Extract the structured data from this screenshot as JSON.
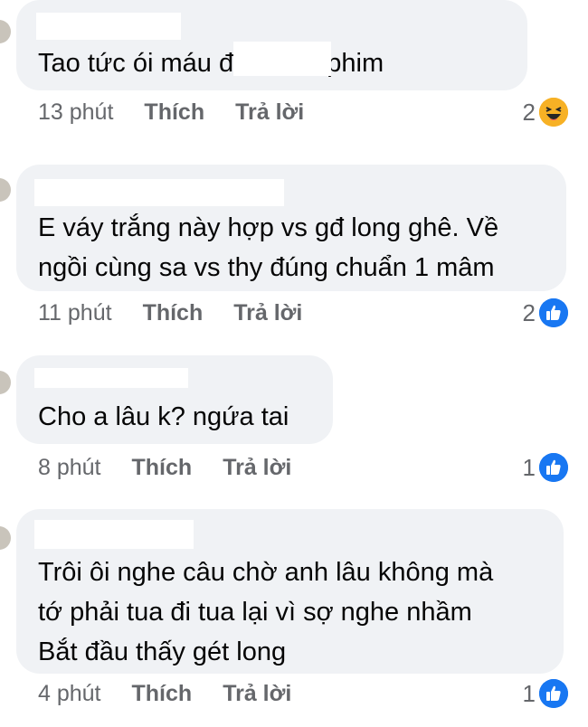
{
  "comments": [
    {
      "text": "Tao tức ói máu               đạo diễn phim",
      "time": "13 phút",
      "like_label": "Thích",
      "reply_label": "Trả lời",
      "reaction_count": "2",
      "reaction_icon": "haha-icon"
    },
    {
      "text": "E váy trắng này hợp vs gđ long ghê. Về\nngồi cùng sa vs thy đúng chuẩn 1 mâm",
      "time": "11 phút",
      "like_label": "Thích",
      "reply_label": "Trả lời",
      "reaction_count": "2",
      "reaction_icon": "like-icon"
    },
    {
      "text": "Cho a lâu k? ngứa tai",
      "time": "8 phút",
      "like_label": "Thích",
      "reply_label": "Trả lời",
      "reaction_count": "1",
      "reaction_icon": "like-icon"
    },
    {
      "text": "Trôi ôi nghe câu chờ anh lâu không mà\ntớ phải tua đi tua lại vì sợ nghe nhầm\nBắt đầu thấy gét long",
      "time": "4 phút",
      "like_label": "Thích",
      "reply_label": "Trả lời",
      "reaction_count": "1",
      "reaction_icon": "like-icon"
    }
  ],
  "colors": {
    "bubble_bg": "#f0f2f5",
    "meta_text": "#65676b",
    "like_blue": "#1877f2",
    "haha_yellow": "#f7b125"
  }
}
